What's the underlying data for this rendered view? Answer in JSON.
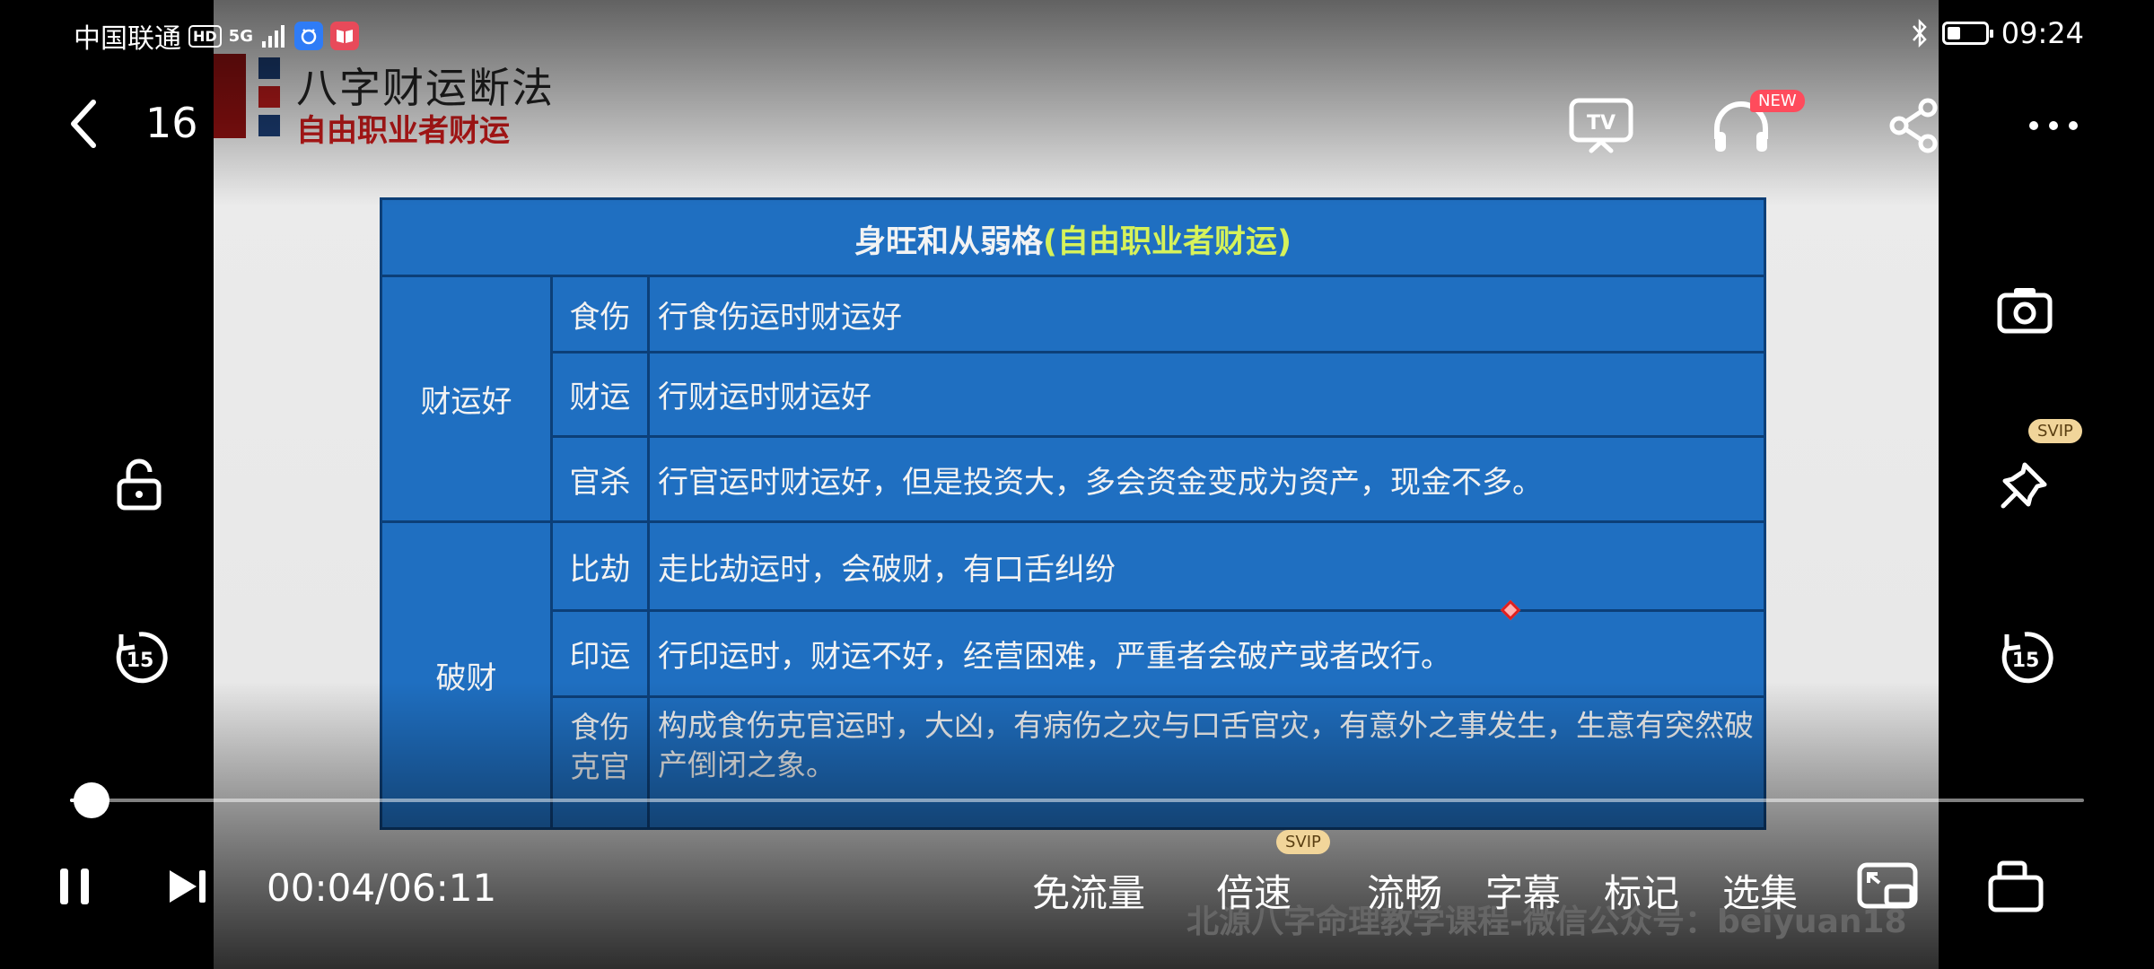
{
  "status_bar": {
    "carrier": "中国联通",
    "hd_label": "HD",
    "signal_label": "5G",
    "time": "09:24"
  },
  "header": {
    "episode_number": "16",
    "new_badge": "NEW"
  },
  "slide": {
    "title": "八字财运断法",
    "subtitle": "自由职业者财运",
    "table_title_main": "身旺和从弱格",
    "table_title_accent": "(自由职业者财运)",
    "group1": "财运好",
    "group2": "破财",
    "rows": [
      {
        "key": "食伤",
        "text": "行食伤运时财运好"
      },
      {
        "key": "财运",
        "text": "行财运时财运好"
      },
      {
        "key": "官杀",
        "text": "行官运时财运好，但是投资大，多会资金变成为资产，现金不多。"
      },
      {
        "key": "比劫",
        "text": "走比劫运时，会破财，有口舌纠纷"
      },
      {
        "key": "印运",
        "text": "行印运时，财运不好，经营困难，严重者会破产或者改行。"
      },
      {
        "key": "食伤\n克官",
        "text": "构成食伤克官运时，大凶，有病伤之灾与口舌官灾，有意外之事发生，生意有突然破产倒闭之象。"
      }
    ],
    "watermark": "北源八字命理教学课程-微信公众号：beiyuan18"
  },
  "side": {
    "svip_right": "SVIP",
    "svip_bottom": "SVIP"
  },
  "player": {
    "progress_fraction": 0.0109,
    "time_display": "00:04/06:11",
    "options": {
      "data_saver": "免流量",
      "speed": "倍速",
      "quality": "流畅",
      "subtitles": "字幕",
      "bookmark": "标记",
      "episodes": "选集"
    }
  },
  "colors": {
    "table_bg": "#1f6fc1",
    "table_border": "#0c3f78",
    "accent_green": "#d6f25a",
    "svip_gold": "#f1d59a",
    "badge_red": "#ff4b5c"
  }
}
